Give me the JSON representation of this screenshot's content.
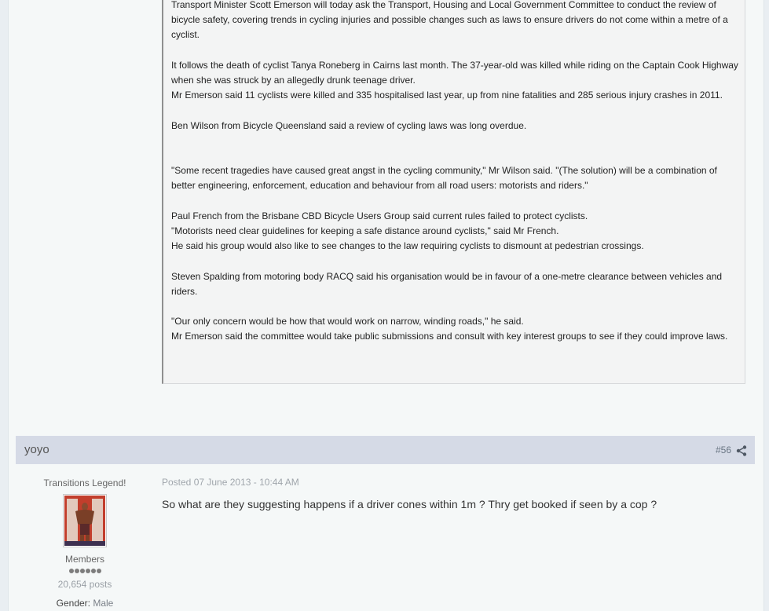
{
  "quoted_post": {
    "paragraphs": [
      "Transport Minister Scott Emerson will today ask the Transport, Housing and Local Government Committee to conduct the review of bicycle safety, covering trends in cycling injuries and possible changes such as laws to ensure drivers do not come within a metre of a cyclist.",
      "It follows the death of cyclist Tanya Roneberg in Cairns last month. The 37-year-old was killed while riding on the Captain Cook Highway when she was struck by an allegedly drunk teenage driver.",
      "Mr Emerson said 11 cyclists were killed and 335 hospitalised last year, up from nine fatalities and 285 serious injury crashes in 2011.",
      "Ben Wilson from Bicycle Queensland said a review of cycling laws was long overdue.",
      "\"Some recent tragedies have caused great angst in the cycling community,\" Mr Wilson said. \"(The solution) will be a combination of better engineering, enforcement, education and behaviour from all road users: motorists and riders.\"",
      "Paul French from the Brisbane CBD Bicycle Users Group said current rules failed to protect cyclists.",
      "\"Motorists need clear guidelines for keeping a safe distance around cyclists,\" said Mr French.",
      "He said his group would also like to see changes to the law requiring cyclists to dismount at pedestrian crossings.",
      "Steven Spalding from motoring body RACQ said his organisation would be in favour of a one-metre clearance between vehicles and riders.",
      "\"Our only concern would be how that would work on narrow, winding roads,\" he said.",
      "Mr Emerson said the committee would take public submissions and consult with key interest groups to see if they could improve laws."
    ]
  },
  "post": {
    "author": "yoyo",
    "number": "#56",
    "share_icon": "share-icon",
    "member_title": "Transitions Legend!",
    "group": "Members",
    "rank_pips": 6,
    "post_count": "20,654 posts",
    "gender_label": "Gender:",
    "gender_value": "Male",
    "posted": "Posted 07 June 2013 - 10:44 AM",
    "body": "So what are they suggesting happens if a driver cones within 1m ? Thry get booked if seen by a cop ?"
  }
}
